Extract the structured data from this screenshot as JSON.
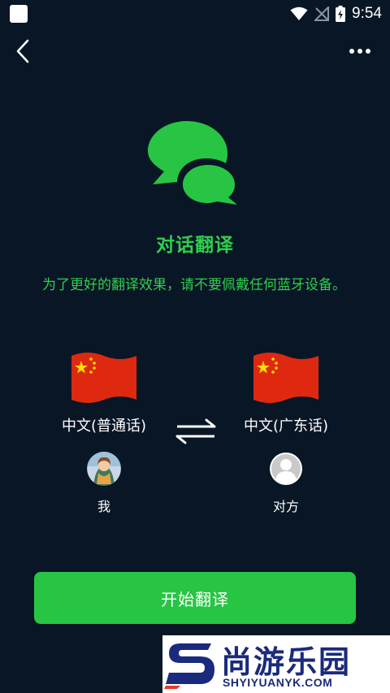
{
  "status_bar": {
    "time": "9:54"
  },
  "header": {
    "back_icon": "chevron-left-icon",
    "more_icon": "more-horizontal-icon"
  },
  "main": {
    "logo_icon": "chat-bubbles-icon",
    "title": "对话翻译",
    "notice": "为了更好的翻译效果，请不要佩戴任何蓝牙设备。"
  },
  "languages": {
    "source": {
      "flag": "china-flag-icon",
      "label": "中文(普通话)"
    },
    "target": {
      "flag": "china-flag-icon",
      "label": "中文(广东话)"
    },
    "swap_icon": "swap-arrows-icon"
  },
  "people": {
    "me": {
      "label": "我"
    },
    "other": {
      "label": "对方"
    }
  },
  "start_button": {
    "label": "开始翻译"
  },
  "watermark": {
    "main": "尚游乐园",
    "sub": "SHYIYUANYK.COM"
  },
  "colors": {
    "background": "#081626",
    "accent": "#27c543",
    "accent_text": "#2fcf4c",
    "flag_red": "#de2910",
    "flag_yellow": "#ffde00"
  }
}
